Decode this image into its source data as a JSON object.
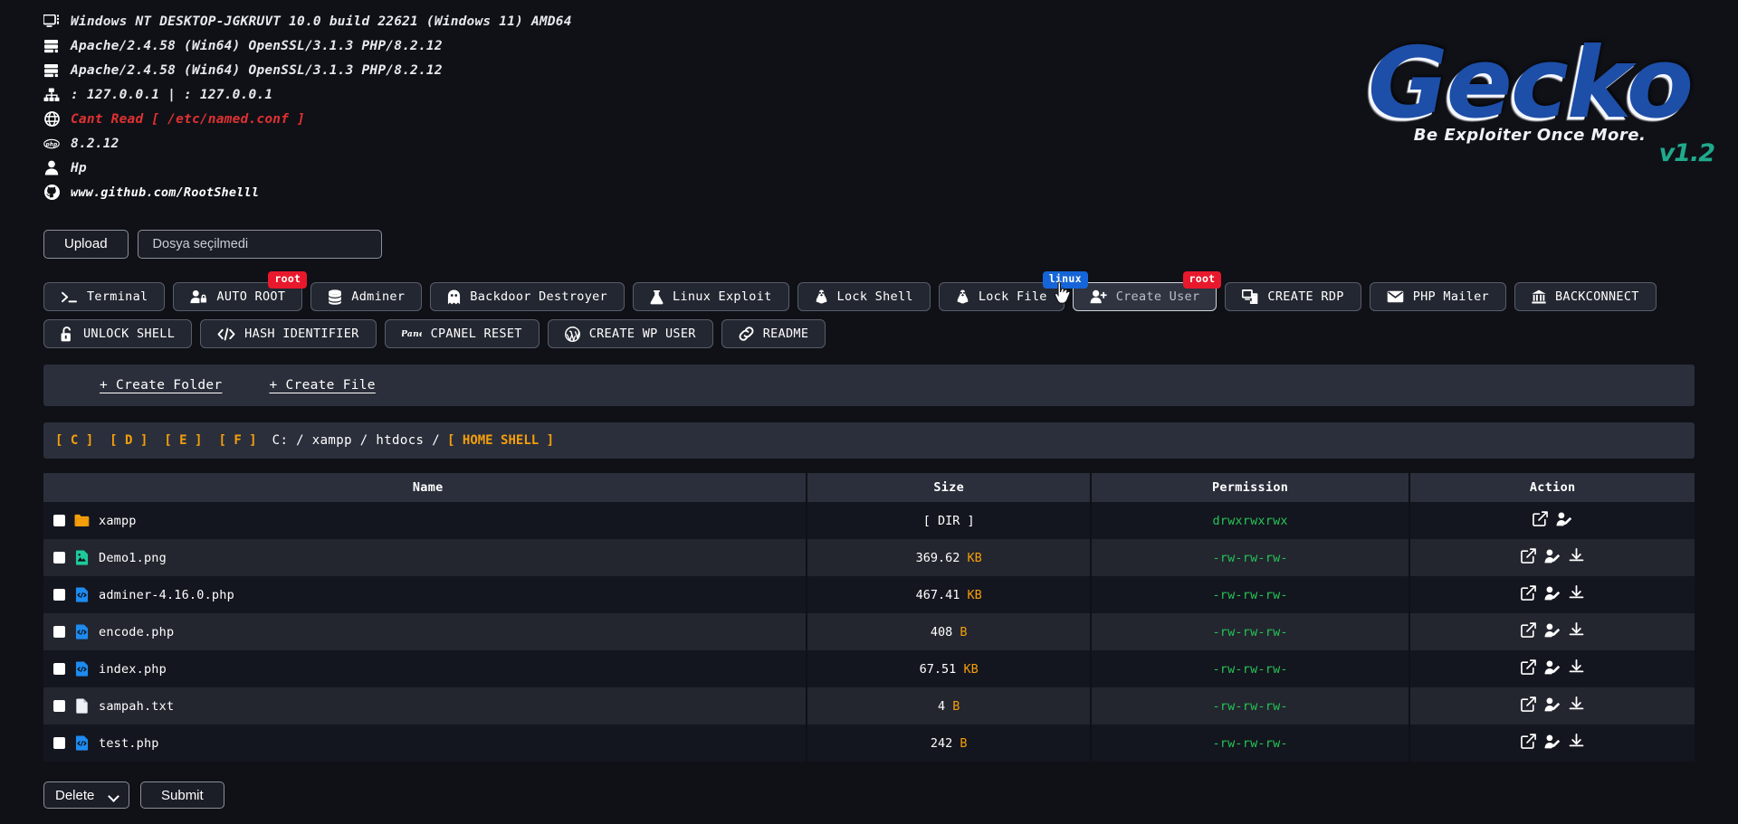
{
  "sysinfo": [
    {
      "icon": "monitor-icon",
      "text": "Windows NT DESKTOP-JGKRUVT 10.0 build 22621 (Windows 11) AMD64",
      "style": "normal"
    },
    {
      "icon": "server-icon",
      "text": "Apache/2.4.58 (Win64) OpenSSL/3.1.3 PHP/8.2.12",
      "style": "normal"
    },
    {
      "icon": "server-icon",
      "text": "Apache/2.4.58 (Win64) OpenSSL/3.1.3 PHP/8.2.12",
      "style": "normal"
    },
    {
      "icon": "network-icon",
      "text": ": 127.0.0.1 | : 127.0.0.1",
      "style": "normal"
    },
    {
      "icon": "globe-icon",
      "text": "Cant Read [ /etc/named.conf ]",
      "style": "error"
    },
    {
      "icon": "php-icon",
      "text": "8.2.12",
      "style": "normal"
    },
    {
      "icon": "user-icon",
      "text": "Hp",
      "style": "normal"
    },
    {
      "icon": "github-icon",
      "text": "www.github.com/RootShelll",
      "style": "link"
    }
  ],
  "logo": {
    "word": "Gecko",
    "tagline": "Be Exploiter Once More.",
    "version": "v1.2",
    "color": "#1d4ea8",
    "version_color": "#1faa8c"
  },
  "upload": {
    "button_label": "Upload",
    "file_status": "Dosya seçilmedi"
  },
  "toolbar": {
    "row1": [
      {
        "label": "Terminal",
        "icon": "terminal-icon",
        "badge": null,
        "hovered": false
      },
      {
        "label": "AUTO ROOT",
        "icon": "user-lock-icon",
        "badge": "root",
        "badge_kind": "root",
        "hovered": false
      },
      {
        "label": "Adminer",
        "icon": "database-icon",
        "badge": null,
        "hovered": false
      },
      {
        "label": "Backdoor Destroyer",
        "icon": "ghost-icon",
        "badge": null,
        "hovered": false
      },
      {
        "label": "Linux Exploit",
        "icon": "flask-icon",
        "badge": null,
        "hovered": false
      },
      {
        "label": "Lock Shell",
        "icon": "tux-icon",
        "badge": null,
        "hovered": false
      },
      {
        "label": "Lock File",
        "icon": "tux-icon",
        "badge": null,
        "hovered": false
      },
      {
        "label": "Create User",
        "icon": "user-plus-icon",
        "badge": "root",
        "badge_kind": "root",
        "badge2": "linux",
        "hovered": true
      },
      {
        "label": "CREATE RDP",
        "icon": "rdp-icon",
        "badge": null,
        "hovered": false
      },
      {
        "label": "PHP Mailer",
        "icon": "envelope-icon",
        "badge": null,
        "hovered": false
      },
      {
        "label": "BACKCONNECT",
        "icon": "bank-icon",
        "badge": null,
        "hovered": false
      }
    ],
    "row2": [
      {
        "label": "UNLOCK SHELL",
        "icon": "unlock-icon",
        "badge": null,
        "hovered": false
      },
      {
        "label": "HASH IDENTIFIER",
        "icon": "code-icon",
        "badge": null,
        "hovered": false
      },
      {
        "label": "CPANEL RESET",
        "icon": "cpanel-icon",
        "badge": null,
        "hovered": false
      },
      {
        "label": "CREATE WP USER",
        "icon": "wordpress-icon",
        "badge": null,
        "hovered": false
      },
      {
        "label": "README",
        "icon": "link-icon",
        "badge": null,
        "hovered": false
      }
    ]
  },
  "create_bar": {
    "folder_label": "+ Create Folder",
    "file_label": "+ Create File"
  },
  "path_bar": {
    "drives": [
      "[ C ]",
      "[ D ]",
      "[ E ]",
      "[ F ]"
    ],
    "segments": "C: / xampp / htdocs /",
    "home": "[ HOME SHELL ]",
    "drive_color": "#f59f0b"
  },
  "table": {
    "headers": [
      "Name",
      "Size",
      "Permission",
      "Action"
    ],
    "rows": [
      {
        "name": "xampp",
        "icon": "folder-icon",
        "size": "[ DIR ]",
        "unit": "",
        "permission": "drwxrwxrwx",
        "perm_color": "#25c455",
        "actions": [
          "edit-icon",
          "rename-icon"
        ]
      },
      {
        "name": "Demo1.png",
        "icon": "image-icon",
        "size": "369.62",
        "unit": "KB",
        "permission": "-rw-rw-rw-",
        "perm_color": "#25c455",
        "actions": [
          "edit-icon",
          "rename-icon",
          "download-icon"
        ]
      },
      {
        "name": "adminer-4.16.0.php",
        "icon": "php-file-icon",
        "size": "467.41",
        "unit": "KB",
        "permission": "-rw-rw-rw-",
        "perm_color": "#25c455",
        "actions": [
          "edit-icon",
          "rename-icon",
          "download-icon"
        ]
      },
      {
        "name": "encode.php",
        "icon": "php-file-icon",
        "size": "408",
        "unit": "B",
        "permission": "-rw-rw-rw-",
        "perm_color": "#25c455",
        "actions": [
          "edit-icon",
          "rename-icon",
          "download-icon"
        ]
      },
      {
        "name": "index.php",
        "icon": "php-file-icon",
        "size": "67.51",
        "unit": "KB",
        "permission": "-rw-rw-rw-",
        "perm_color": "#25c455",
        "actions": [
          "edit-icon",
          "rename-icon",
          "download-icon"
        ]
      },
      {
        "name": "sampah.txt",
        "icon": "text-file-icon",
        "size": "4",
        "unit": "B",
        "permission": "-rw-rw-rw-",
        "perm_color": "#25c455",
        "actions": [
          "edit-icon",
          "rename-icon",
          "download-icon"
        ]
      },
      {
        "name": "test.php",
        "icon": "php-file-icon",
        "size": "242",
        "unit": "B",
        "permission": "-rw-rw-rw-",
        "perm_color": "#25c455",
        "actions": [
          "edit-icon",
          "rename-icon",
          "download-icon"
        ]
      }
    ]
  },
  "footer": {
    "action_selected": "Delete",
    "action_options": [
      "Delete"
    ],
    "submit_label": "Submit"
  }
}
